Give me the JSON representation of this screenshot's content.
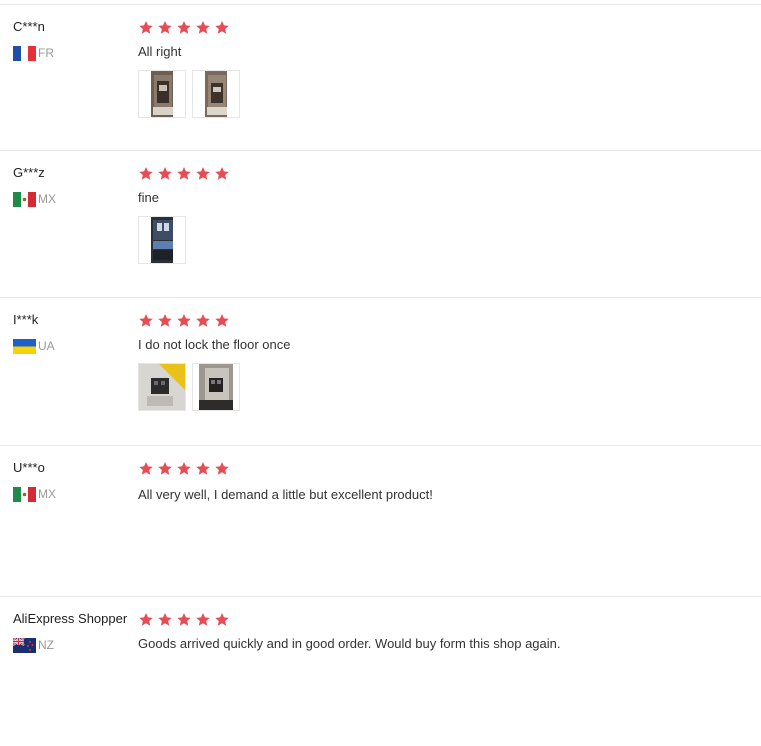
{
  "star_color": "#e74c55",
  "reviews": [
    {
      "name": "C***n",
      "flag": "flag-fr-icon",
      "country": "FR",
      "rating": 5,
      "text": "All right",
      "photos": [
        "product-photo",
        "product-photo"
      ]
    },
    {
      "name": "G***z",
      "flag": "flag-mx-icon",
      "country": "MX",
      "rating": 5,
      "text": "fine",
      "photos": [
        "product-photo"
      ]
    },
    {
      "name": "I***k",
      "flag": "flag-ua-icon",
      "country": "UA",
      "rating": 5,
      "text": "I do not lock the floor once",
      "photos": [
        "product-photo",
        "product-photo"
      ]
    },
    {
      "name": "U***o",
      "flag": "flag-mx-icon",
      "country": "MX",
      "rating": 5,
      "text": "All very well, I demand a little but excellent product!",
      "photos": []
    },
    {
      "name": "AliExpress Shopper",
      "flag": "flag-nz-icon",
      "country": "NZ",
      "rating": 5,
      "text": "Goods arrived quickly and in good order. Would buy form this shop again.",
      "photos": []
    }
  ]
}
